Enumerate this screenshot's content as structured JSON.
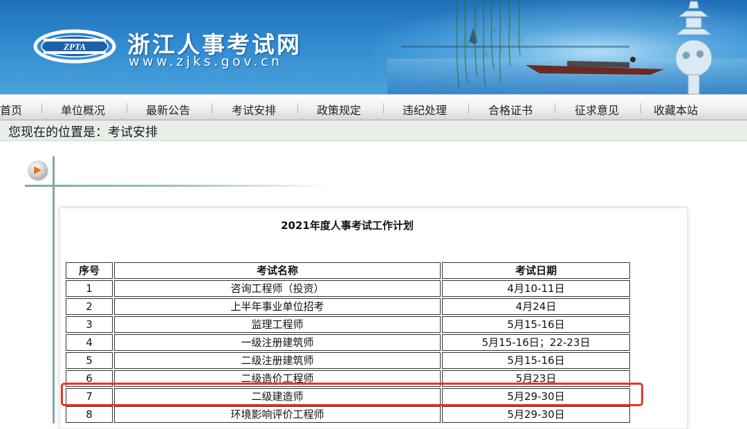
{
  "header": {
    "site_title": "浙江人事考试网",
    "site_url": "www.zjks.gov.cn",
    "logo_text": "ZPTA"
  },
  "nav": {
    "items": [
      "首页",
      "单位概况",
      "最新公告",
      "考试安排",
      "政策规定",
      "违纪处理",
      "合格证书",
      "征求意见",
      "收藏本站"
    ]
  },
  "breadcrumb": {
    "text": "您现在的位置是：考试安排"
  },
  "plan": {
    "title": "2021年度人事考试工作计划",
    "columns": [
      "序号",
      "考试名称",
      "考试日期"
    ],
    "rows": [
      [
        "1",
        "咨询工程师（投资）",
        "4月10-11日"
      ],
      [
        "2",
        "上半年事业单位招考",
        "4月24日"
      ],
      [
        "3",
        "监理工程师",
        "5月15-16日"
      ],
      [
        "4",
        "一级注册建筑师",
        "5月15-16日；22-23日"
      ],
      [
        "5",
        "二级注册建筑师",
        "5月15-16日"
      ],
      [
        "6",
        "二级造价工程师",
        "5月23日"
      ],
      [
        "7",
        "二级建造师",
        "5月29-30日"
      ],
      [
        "8",
        "环境影响评价工程师",
        "5月29-30日"
      ]
    ],
    "highlighted_row": "7"
  },
  "colors": {
    "banner": "#2f8ad0",
    "highlight": "#e8332a",
    "frame_line": "#7ea8a2",
    "breadcrumb_bg": "#e7eee7"
  }
}
